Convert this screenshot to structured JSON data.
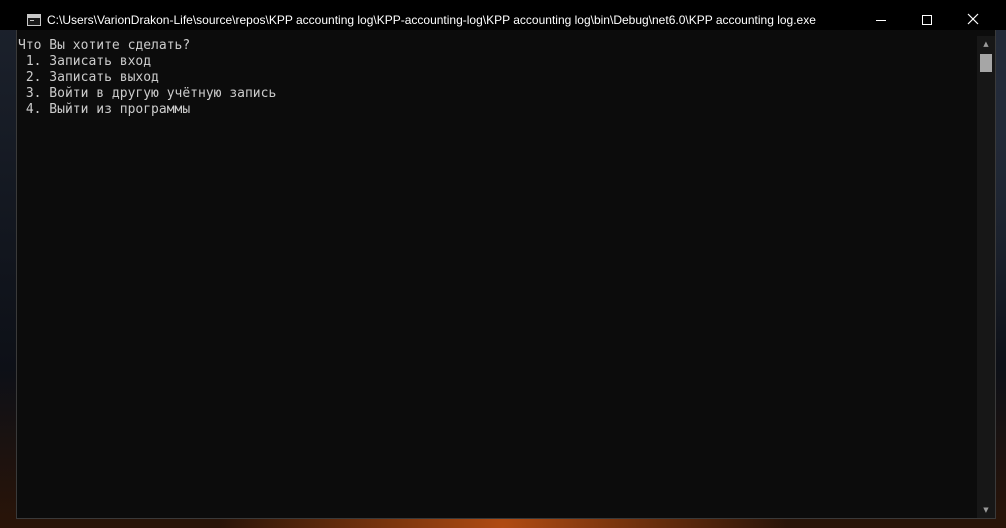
{
  "window": {
    "title": "C:\\Users\\VarionDrakon-Life\\source\\repos\\KPP accounting log\\KPP-accounting-log\\KPP accounting log\\bin\\Debug\\net6.0\\KPP accounting log.exe",
    "app_icon": "console-window-icon",
    "controls": {
      "minimize_icon": "minimize-icon",
      "maximize_icon": "maximize-icon",
      "close_icon": "close-icon"
    }
  },
  "console": {
    "lines": [
      "Что Вы хотите сделать?",
      " 1. Записать вход",
      " 2. Записать выход",
      " 3. Войти в другую учётную запись",
      " 4. Выйти из программы"
    ],
    "background_color": "#0c0c0c",
    "text_color": "#cccccc"
  },
  "scrollbar": {
    "up_icon": "arrow-up-icon",
    "down_icon": "arrow-down-icon"
  }
}
